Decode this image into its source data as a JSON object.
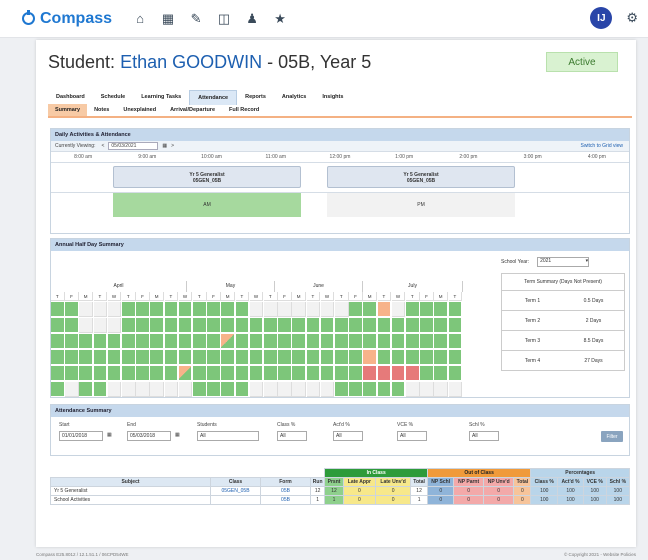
{
  "app": {
    "name": "Compass"
  },
  "user": {
    "initials": "IJ"
  },
  "student": {
    "prefix": "Student:",
    "name": "Ethan GOODWIN",
    "suffix": "- 05B, Year 5",
    "status": "Active"
  },
  "tabs": [
    "Dashboard",
    "Schedule",
    "Learning Tasks",
    "Attendance",
    "Reports",
    "Analytics",
    "Insights"
  ],
  "subtabs": [
    "Summary",
    "Notes",
    "Unexplained",
    "Arrival/Departure",
    "Full Record"
  ],
  "daily": {
    "title": "Daily Activities & Attendance",
    "viewing_label": "Currently Viewing:",
    "date": "05/03/2021",
    "grid_link": "Switch to Grid view",
    "times": [
      "8:00 am",
      "9:00 am",
      "10:00 am",
      "11:00 am",
      "12:00 pm",
      "1:00 pm",
      "2:00 pm",
      "3:00 pm",
      "4:00 pm"
    ],
    "class_am": {
      "line1": "Yr 5 Generalist",
      "line2": "05GEN_05B"
    },
    "class_pm": {
      "line1": "Yr 5 Generalist",
      "line2": "05GEN_05B"
    },
    "am": "AM",
    "pm": "PM"
  },
  "annual": {
    "title": "Annual Half Day Summary",
    "months": [
      "April",
      "May",
      "June",
      "July"
    ],
    "day_letters": [
      "T",
      "F",
      "M",
      "T",
      "W",
      "T",
      "F",
      "M",
      "T",
      "W",
      "T",
      "F",
      "M",
      "T",
      "W",
      "T",
      "F",
      "M",
      "T",
      "W",
      "T",
      "F",
      "M",
      "T",
      "W",
      "T",
      "F",
      "M",
      "T"
    ],
    "school_year_label": "School Year:",
    "school_year": "2021",
    "term_summary_title": "Term Summary (Days Not Present)",
    "terms": [
      {
        "term": "Term 1",
        "days": "0.5 Days"
      },
      {
        "term": "Term 2",
        "days": "2 Days"
      },
      {
        "term": "Term 3",
        "days": "8.5 Days"
      },
      {
        "term": "Term 4",
        "days": "27 Days"
      }
    ]
  },
  "filter": {
    "title": "Attendance Summary",
    "start_label": "Start",
    "start": "01/01/2018",
    "end_label": "End",
    "end": "05/03/2018",
    "students_label": "Students",
    "students": "All",
    "class_label": "Class %",
    "class": "All",
    "acted_label": "Act'd %",
    "acted": "All",
    "vce_label": "VCE %",
    "vce": "All",
    "schl_label": "Schl %",
    "schl": "All",
    "button": "Filter"
  },
  "table": {
    "groups": {
      "in": "In Class",
      "out": "Out of Class",
      "pct": "Percentages"
    },
    "headers": [
      "Subject",
      "Class",
      "Form",
      "Run",
      "Prsnt",
      "Late Appr",
      "Late Unv'd",
      "Total",
      "NP Schl",
      "NP Parnt",
      "NP Unv'd",
      "Total",
      "Class %",
      "Act'd %",
      "VCE %",
      "Schl %"
    ],
    "rows": [
      [
        "Yr 5 Generalist",
        "05GEN_05B",
        "05B",
        "12",
        "12",
        "0",
        "0",
        "12",
        "0",
        "0",
        "0",
        "0",
        "100",
        "100",
        "100",
        "100"
      ],
      [
        "School Activities",
        "",
        "05B",
        "1",
        "1",
        "0",
        "0",
        "1",
        "0",
        "0",
        "0",
        "0",
        "100",
        "100",
        "100",
        "100"
      ]
    ]
  },
  "footer": {
    "left": "Compass E25.8012 / 12.1.51.1 / 06CPD54WE",
    "right": "© Copyright 2021 - Website Policies"
  },
  "colors": {
    "brand": "#1f78d1",
    "present": "#7dc67a",
    "partial": "#f7b38a",
    "absent": "#e67a7a"
  }
}
